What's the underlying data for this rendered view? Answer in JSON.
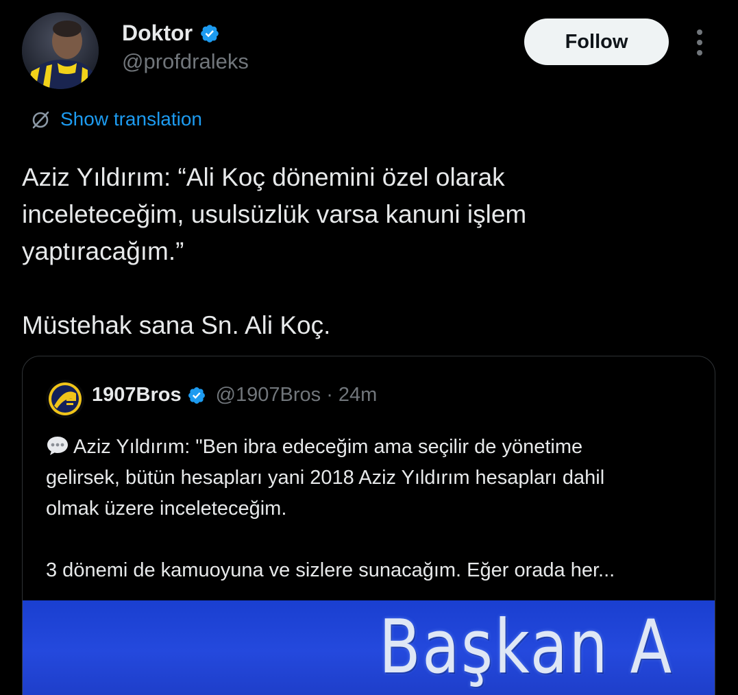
{
  "author": {
    "display_name": "Doktor",
    "handle": "@profdraleks",
    "verified": true,
    "avatar_icon": "profile-photo"
  },
  "actions": {
    "follow_label": "Follow",
    "more_icon": "more-vertical-icon"
  },
  "translation": {
    "label": "Show translation",
    "icon": "globe-icon"
  },
  "tweet": {
    "text_line1": "Aziz Yıldırım: “Ali Koç dönemini özel olarak\ninceleteceğim, usulsüzlük varsa kanuni işlem\nyaptıracağım.”",
    "text_line2": "Müstehak sana Sn. Ali Koç."
  },
  "quoted_tweet": {
    "display_name": "1907Bros",
    "handle": "@1907Bros",
    "separator": "·",
    "time": "24m",
    "verified": true,
    "emoji_icon": "speech-balloon-icon",
    "body_para1": "Aziz Yıldırım: \"Ben ibra edeceğim ama seçilir de yönetime\ngelirsek, bütün hesapları yani 2018 Aziz Yıldırım hesapları dahil\nolmak üzere inceleteceğim.",
    "body_para2": "3 dönemi de kamuoyuna ve sizlere sunacağım. Eğer orada her...",
    "media_text": "Başkan A"
  },
  "colors": {
    "background": "#000000",
    "text": "#e7e9ea",
    "muted": "#71767b",
    "link": "#1d9bf0",
    "verified": "#1d9bf0",
    "follow_bg": "#eff3f4"
  }
}
